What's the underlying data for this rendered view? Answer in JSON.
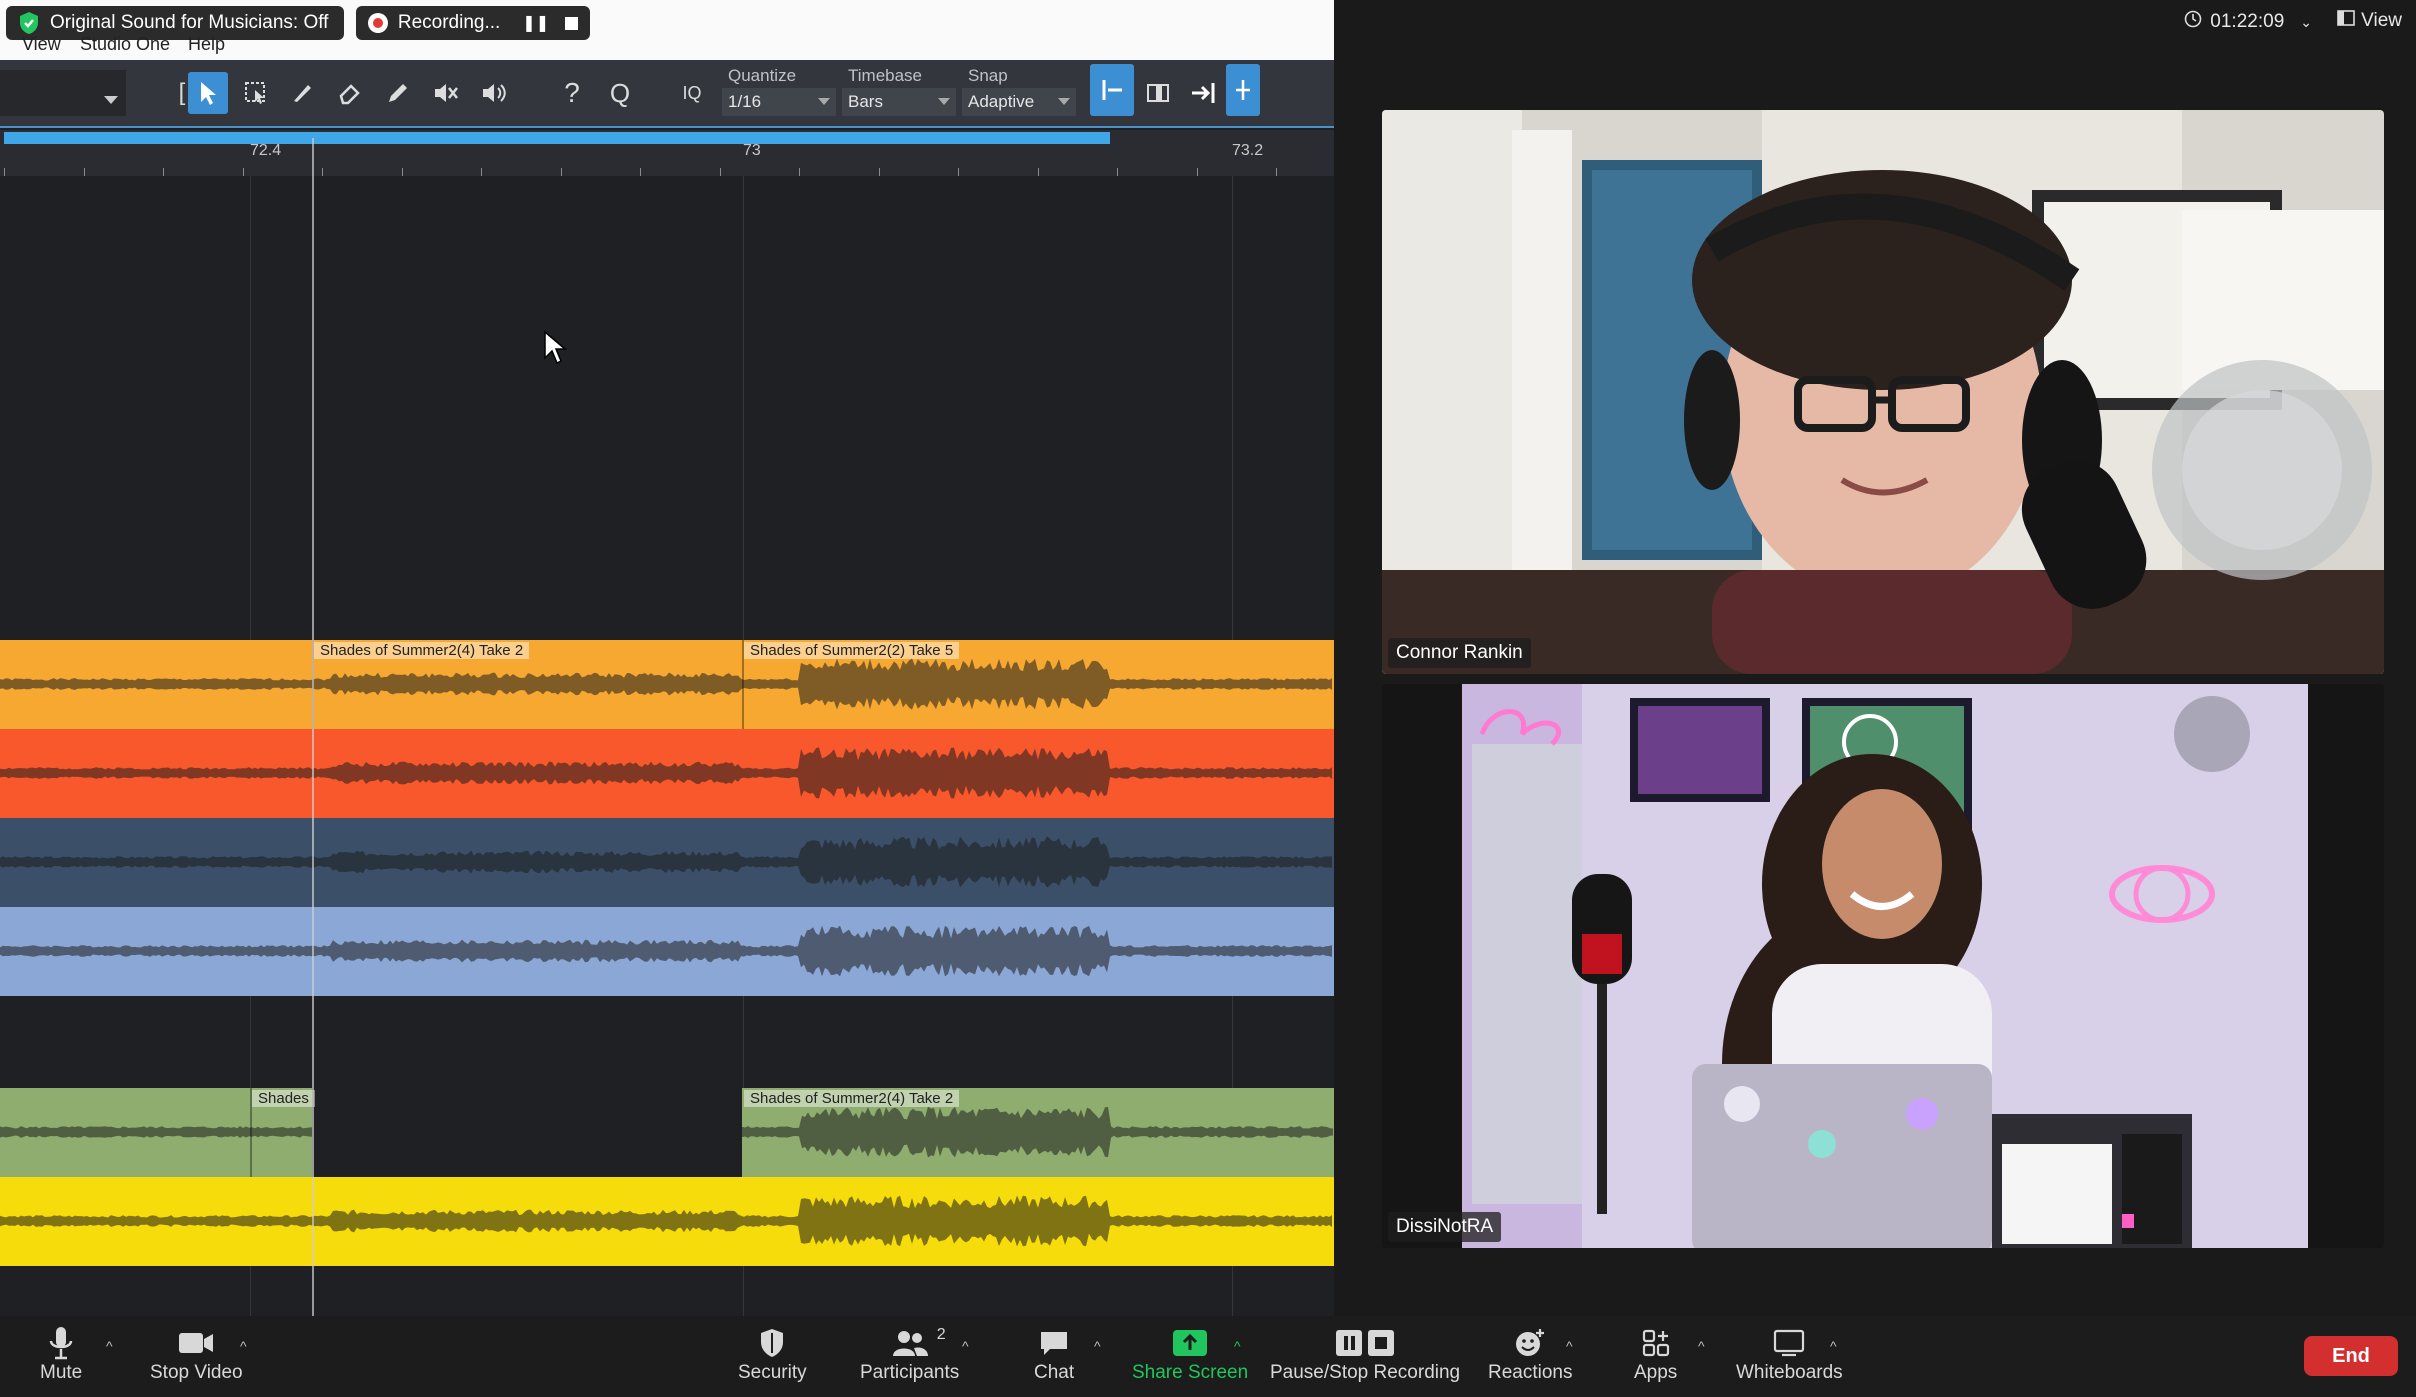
{
  "top_pills": {
    "original_sound": "Original Sound for Musicians: Off",
    "recording": "Recording..."
  },
  "daw_menu": [
    "View",
    "Studio One",
    "Help"
  ],
  "toolbar": {
    "quantize_label": "Quantize",
    "quantize_value": "1/16",
    "timebase_label": "Timebase",
    "timebase_value": "Bars",
    "snap_label": "Snap",
    "snap_value": "Adaptive",
    "iq_label": "IQ"
  },
  "ruler": {
    "labels": [
      "72.4",
      "73",
      "73.2"
    ]
  },
  "clips": {
    "take2_a": "Shades of Summer2(4) Take 2",
    "take5": "Shades of Summer2(2) Take 5",
    "shades_short": "Shades",
    "take2_b": "Shades of Summer2(4) Take 2"
  },
  "track_colors": [
    "#f7a830",
    "#f9572c",
    "#3b5068",
    "#8aa7d6",
    "#8fad6f",
    "#f6dc0a"
  ],
  "meeting": {
    "timer": "01:22:09",
    "view_label": "View",
    "participants": [
      {
        "name": "Connor Rankin"
      },
      {
        "name": "DissiNotRA"
      }
    ]
  },
  "controls": {
    "mute": "Mute",
    "stop_video": "Stop Video",
    "security": "Security",
    "participants": "Participants",
    "participants_count": "2",
    "chat": "Chat",
    "share_screen": "Share Screen",
    "pause_stop_recording": "Pause/Stop Recording",
    "reactions": "Reactions",
    "apps": "Apps",
    "whiteboards": "Whiteboards",
    "end": "End"
  }
}
